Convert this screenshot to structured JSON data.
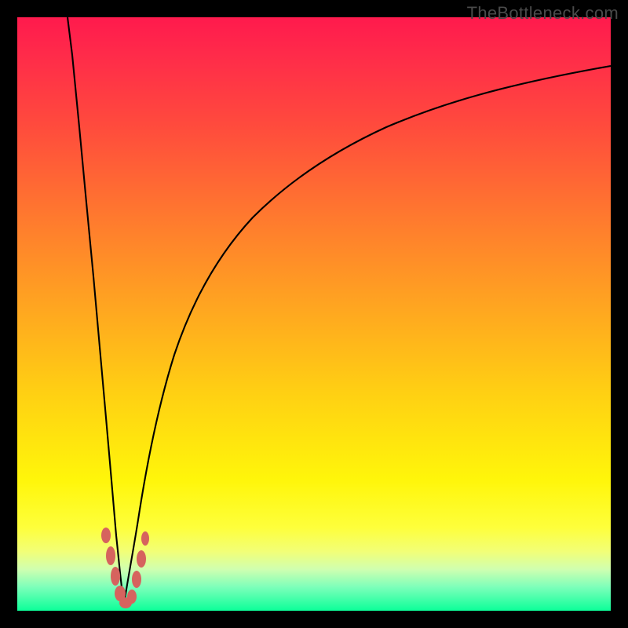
{
  "watermark": "TheBottleneck.com",
  "colors": {
    "frame_bg": "#000000",
    "curve": "#000000",
    "blob": "#d6635e",
    "gradient_top": "#ff1a4d",
    "gradient_bottom": "#0cff99"
  },
  "chart_data": {
    "type": "line",
    "title": "",
    "xlabel": "",
    "ylabel": "",
    "x_range": [
      0,
      100
    ],
    "y_range": [
      0,
      100
    ],
    "notes": "Axes are unlabeled; values are fractional positions (0–100) read from the plot area. Left branch falls steeply from top-left toward the dip; right branch rises with a decelerating curve toward upper-right.",
    "series": [
      {
        "name": "left-branch",
        "x": [
          8.5,
          9,
          10,
          11,
          12,
          13,
          14,
          15,
          16,
          17,
          18
        ],
        "y": [
          100,
          93,
          80,
          67,
          53,
          40,
          28,
          17,
          9,
          3.5,
          0.8
        ]
      },
      {
        "name": "right-branch",
        "x": [
          18,
          19,
          20,
          22,
          25,
          30,
          35,
          40,
          48,
          58,
          70,
          84,
          100
        ],
        "y": [
          0.8,
          4,
          10,
          22,
          37,
          52,
          61,
          68,
          75,
          81,
          86,
          89.5,
          92
        ]
      }
    ],
    "annotations": [
      {
        "name": "highlight-blobs",
        "shape": "irregular-dots",
        "color": "#d6635e",
        "approx_center": {
          "x": 17.5,
          "y": 6
        },
        "approx_extent": {
          "x": [
            14,
            21
          ],
          "y": [
            1,
            14
          ]
        }
      }
    ]
  }
}
